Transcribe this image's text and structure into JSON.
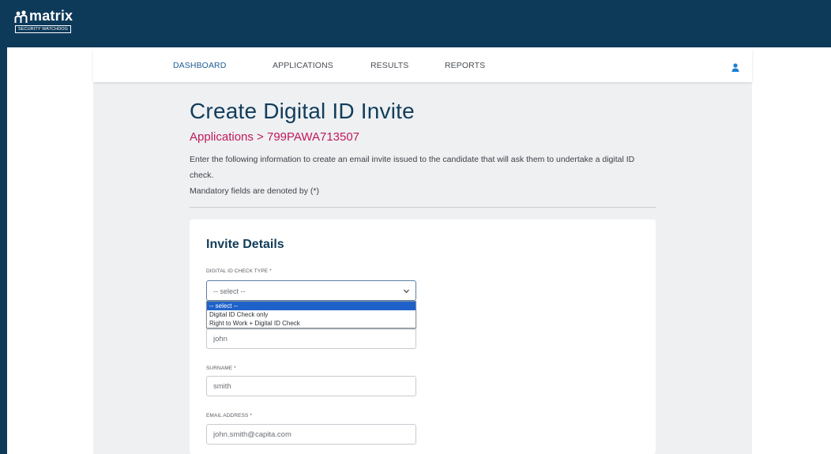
{
  "brand": {
    "name": "matrix",
    "tagline": "SECURITY WATCHDOG"
  },
  "nav": {
    "items": [
      {
        "label": "DASHBOARD",
        "active": true
      },
      {
        "label": "APPLICATIONS",
        "active": false
      },
      {
        "label": "RESULTS",
        "active": false
      },
      {
        "label": "REPORTS",
        "active": false
      }
    ],
    "user_icon": "user-icon"
  },
  "page": {
    "title": "Create Digital ID Invite",
    "breadcrumb_root": "Applications",
    "breadcrumb_sep": " > ",
    "breadcrumb_current": "799PAWA713507",
    "intro": "Enter the following information to create an email invite issued to the candidate that will ask them to undertake a digital ID check.",
    "mandatory_note": "Mandatory fields are denoted by (*)"
  },
  "form": {
    "card_title": "Invite Details",
    "check_type": {
      "label": "DIGITAL ID CHECK TYPE *",
      "value": "-- select --",
      "options": [
        "-- select --",
        "Digital ID Check only",
        "Right to Work + Digital ID Check"
      ],
      "highlighted_index": 0
    },
    "forename": {
      "value": "john"
    },
    "surname": {
      "label": "SURNAME *",
      "value": "smith"
    },
    "email": {
      "label": "EMAIL ADDRESS *",
      "value": "john.smith@capita.com"
    }
  },
  "colors": {
    "header_bg": "#0e3a5a",
    "nav_active": "#1f5e93",
    "breadcrumb": "#c2185b",
    "title": "#123d5b",
    "option_highlight": "#1e62c9"
  }
}
